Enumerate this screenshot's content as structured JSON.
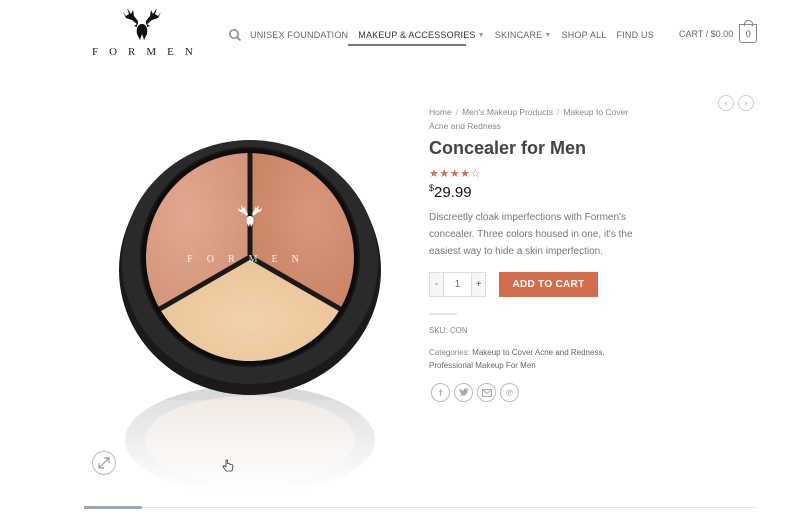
{
  "header": {
    "logo_text": "FORMEN",
    "nav": [
      {
        "label": "UNISEX FOUNDATION",
        "has_dropdown": false,
        "active": false
      },
      {
        "label": "MAKEUP & ACCESSORIES",
        "has_dropdown": true,
        "active": true
      },
      {
        "label": "SKINCARE",
        "has_dropdown": true,
        "active": false
      },
      {
        "label": "SHOP ALL",
        "has_dropdown": false,
        "active": false
      },
      {
        "label": "FIND US",
        "has_dropdown": false,
        "active": false
      }
    ],
    "cart_label": "CART / $0.00",
    "cart_count": "0"
  },
  "product": {
    "breadcrumb": {
      "home": "Home",
      "category": "Men's Makeup Products",
      "subcategory": "Makeup to Cover Acne and Redness"
    },
    "title": "Concealer for Men",
    "rating_stars": "★★★★☆",
    "rating_value": 4.5,
    "currency": "$",
    "price": "29.99",
    "description": "Discreetly cloak imperfections with Formen's concealer. Three colors housed in one, it's the easiest way to hide a skin imperfection.",
    "quantity": "1",
    "qty_minus": "-",
    "qty_plus": "+",
    "add_to_cart": "ADD TO CART",
    "sku_label": "SKU:",
    "sku_value": "CON",
    "categories_label": "Categories:",
    "categories_value": "Makeup to Cover Acne and Redness, Professional Makeup For Men",
    "image_brand": "FORMEN"
  },
  "icons": {
    "share": [
      "facebook-icon",
      "twitter-icon",
      "email-icon",
      "pinterest-icon"
    ]
  },
  "colors": {
    "accent": "#d26e4b"
  }
}
